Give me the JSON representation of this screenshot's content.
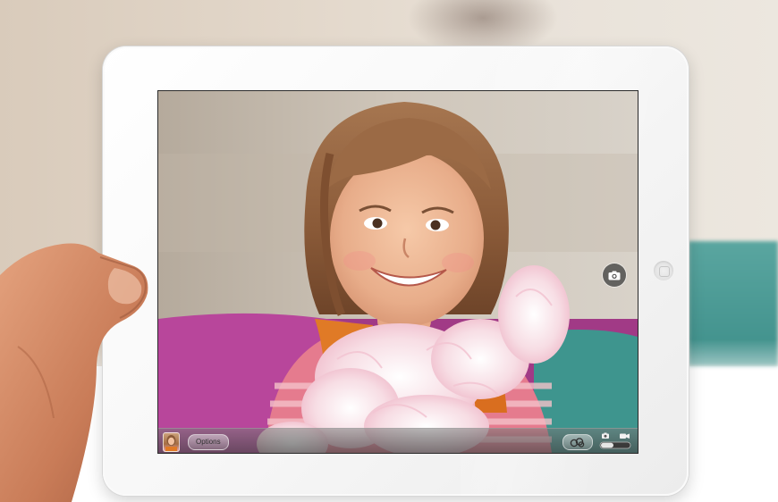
{
  "screen": {
    "options_label": "Options",
    "icons": {
      "switch_camera": "camera-icon",
      "effects": "effects-icon",
      "mode": "photo-video-switch-icon"
    }
  },
  "colors": {
    "ipad_bezel": "#f4f4f4",
    "toolbar": "#5a5a5a",
    "teal_background": "#4a9b95"
  }
}
